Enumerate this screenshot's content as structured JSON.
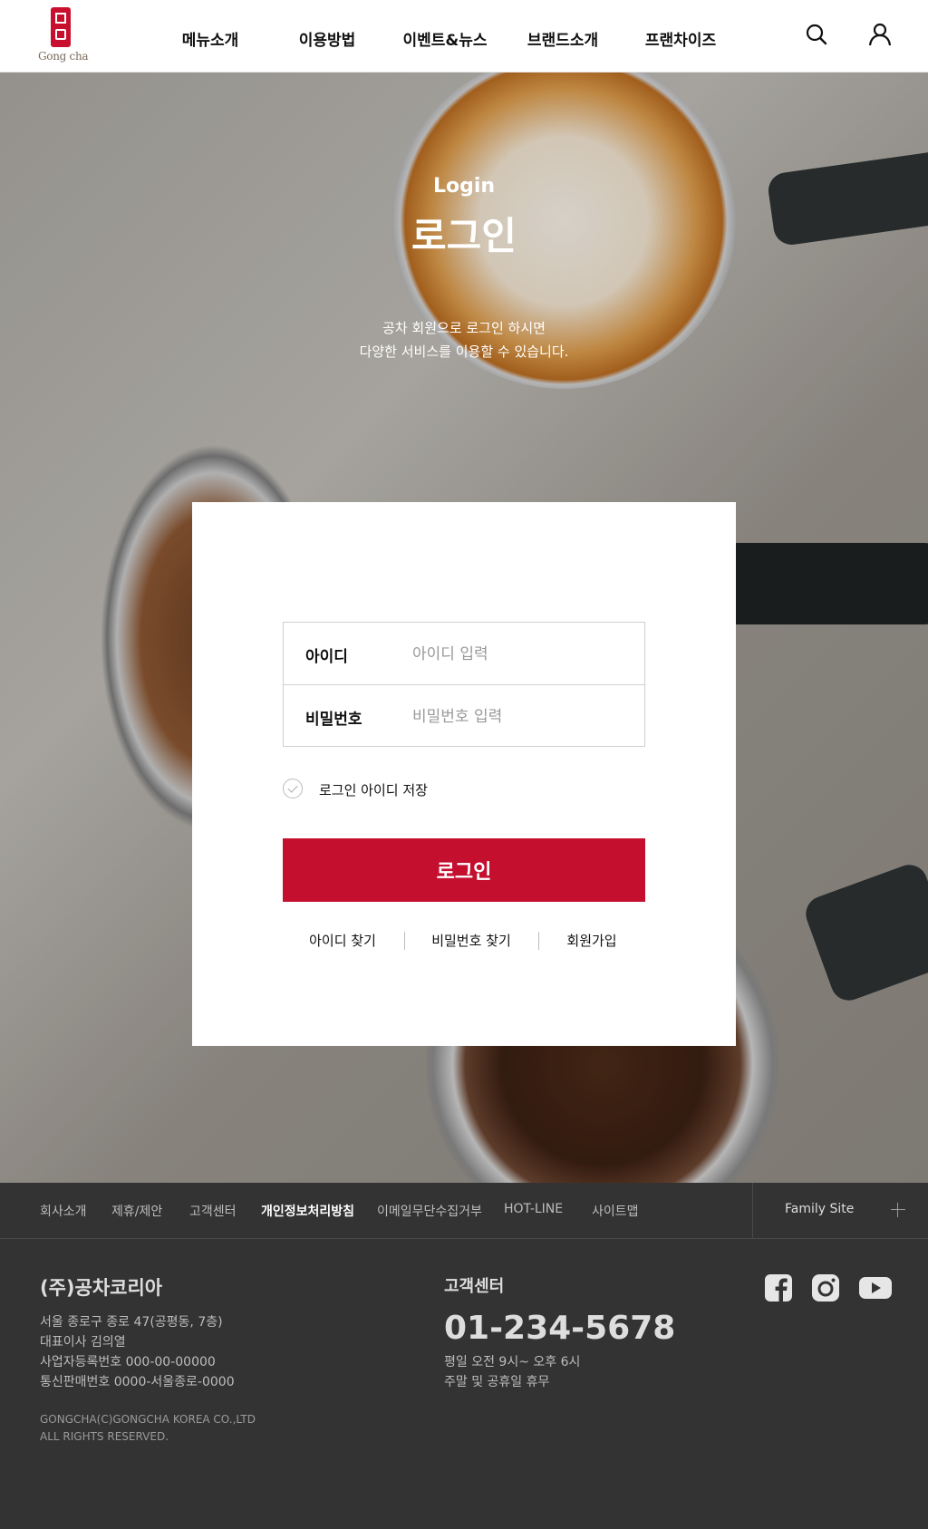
{
  "header": {
    "logo_text": "Gong cha",
    "nav": [
      "메뉴소개",
      "이용방법",
      "이벤트&뉴스",
      "브랜드소개",
      "프랜차이즈"
    ]
  },
  "hero": {
    "subtitle": "Login",
    "title": "로그인",
    "desc_line1": "공차 회원으로 로그인 하시면",
    "desc_line2": "다양한 서비스를 이용할 수 있습니다."
  },
  "login": {
    "id_label": "아이디",
    "id_placeholder": "아이디 입력",
    "pw_label": "비밀번호",
    "pw_placeholder": "비밀번호 입력",
    "save_id_label": "로그인 아이디 저장",
    "button": "로그인",
    "links": [
      "아이디 찾기",
      "비밀번호 찾기",
      "회원가입"
    ]
  },
  "footer": {
    "nav": [
      "회사소개",
      "제휴/제안",
      "고객센터",
      "개인정보처리방침",
      "이메일무단수집거부",
      "HOT-LINE",
      "사이트맵"
    ],
    "family_site": "Family Site",
    "company_name": "(주)공차코리아",
    "info": [
      "서울 종로구 종로 47(공평동, 7층)",
      "대표이사 김의열",
      "사업자등록번호 000-00-00000",
      "통신판매번호 0000-서울종로-0000"
    ],
    "copyright": [
      "GONGCHA(C)GONGCHA KOREA CO.,LTD",
      "ALL RIGHTS RESERVED."
    ],
    "cs_title": "고객센터",
    "cs_phone": "01-234-5678",
    "cs_hours": [
      "평일 오전 9시~ 오후 6시",
      "주말 및 공휴일 휴무"
    ],
    "social": [
      "facebook-icon",
      "instagram-icon",
      "youtube-icon"
    ]
  },
  "colors": {
    "brand_red": "#c40f2f",
    "footer_bg": "#333333"
  }
}
